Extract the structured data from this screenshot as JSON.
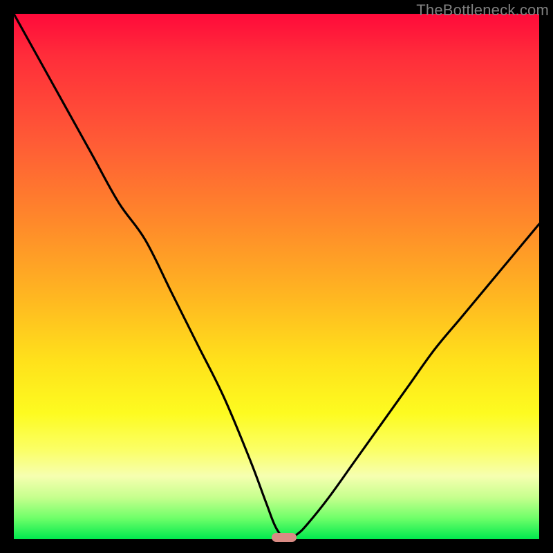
{
  "watermark": "TheBottleneck.com",
  "marker": {
    "x_pct": 51.5,
    "y_pct": 100
  },
  "chart_data": {
    "type": "line",
    "title": "",
    "xlabel": "",
    "ylabel": "",
    "xlim": [
      0,
      100
    ],
    "ylim": [
      0,
      100
    ],
    "series": [
      {
        "name": "bottleneck-curve",
        "x": [
          0,
          5,
          10,
          15,
          20,
          25,
          30,
          35,
          40,
          45,
          48,
          50,
          52,
          54,
          56,
          60,
          65,
          70,
          75,
          80,
          85,
          90,
          95,
          100
        ],
        "y": [
          100,
          91,
          82,
          73,
          64,
          57,
          47,
          37,
          27,
          15,
          7,
          2,
          0,
          1,
          3,
          8,
          15,
          22,
          29,
          36,
          42,
          48,
          54,
          60
        ]
      }
    ],
    "annotations": [
      {
        "text": "TheBottleneck.com",
        "role": "watermark",
        "pos": "top-right"
      }
    ],
    "gradient_stops": [
      {
        "pct": 0,
        "color": "#ff0a3a"
      },
      {
        "pct": 24,
        "color": "#ff5a36"
      },
      {
        "pct": 54,
        "color": "#ffb721"
      },
      {
        "pct": 76,
        "color": "#fdfb20"
      },
      {
        "pct": 92,
        "color": "#c7ff8e"
      },
      {
        "pct": 100,
        "color": "#00e94e"
      }
    ]
  }
}
